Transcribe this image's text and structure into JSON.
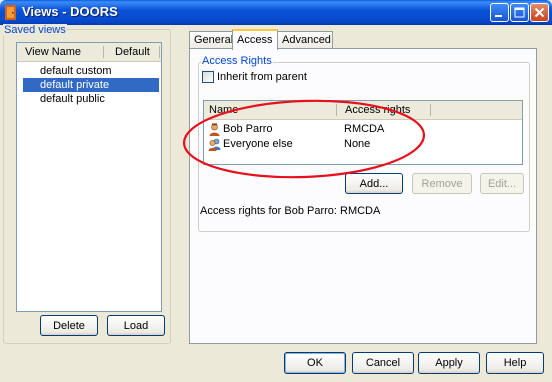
{
  "window": {
    "title": "Views - DOORS",
    "controls": [
      "minimize-icon",
      "maximize-icon",
      "close-icon"
    ]
  },
  "saved_views": {
    "legend": "Saved views",
    "columns": [
      "View Name",
      "Default"
    ],
    "items": [
      {
        "name": "default custom",
        "selected": false
      },
      {
        "name": "default private",
        "selected": true
      },
      {
        "name": "default public",
        "selected": false
      }
    ],
    "delete_label": "Delete",
    "load_label": "Load"
  },
  "tabs": [
    {
      "label": "General",
      "active": false
    },
    {
      "label": "Access",
      "active": true
    },
    {
      "label": "Advanced",
      "active": false
    }
  ],
  "access": {
    "legend": "Access Rights",
    "inherit_label": "Inherit from parent",
    "inherit_checked": false,
    "columns": [
      "Name",
      "Access rights"
    ],
    "rows": [
      {
        "name": "Bob Parro",
        "rights": "RMCDA",
        "icon": "user-icon"
      },
      {
        "name": "Everyone else",
        "rights": "None",
        "icon": "group-icon"
      }
    ],
    "add_label": "Add...",
    "remove_label": "Remove",
    "edit_label": "Edit...",
    "status": "Access rights for Bob Parro: RMCDA"
  },
  "footer": {
    "ok_label": "OK",
    "cancel_label": "Cancel",
    "apply_label": "Apply",
    "help_label": "Help"
  },
  "colors": {
    "titlebar": "#0a52d8",
    "selection": "#316ac5",
    "legend_text": "#0046d5",
    "annotation": "#e8101c"
  }
}
